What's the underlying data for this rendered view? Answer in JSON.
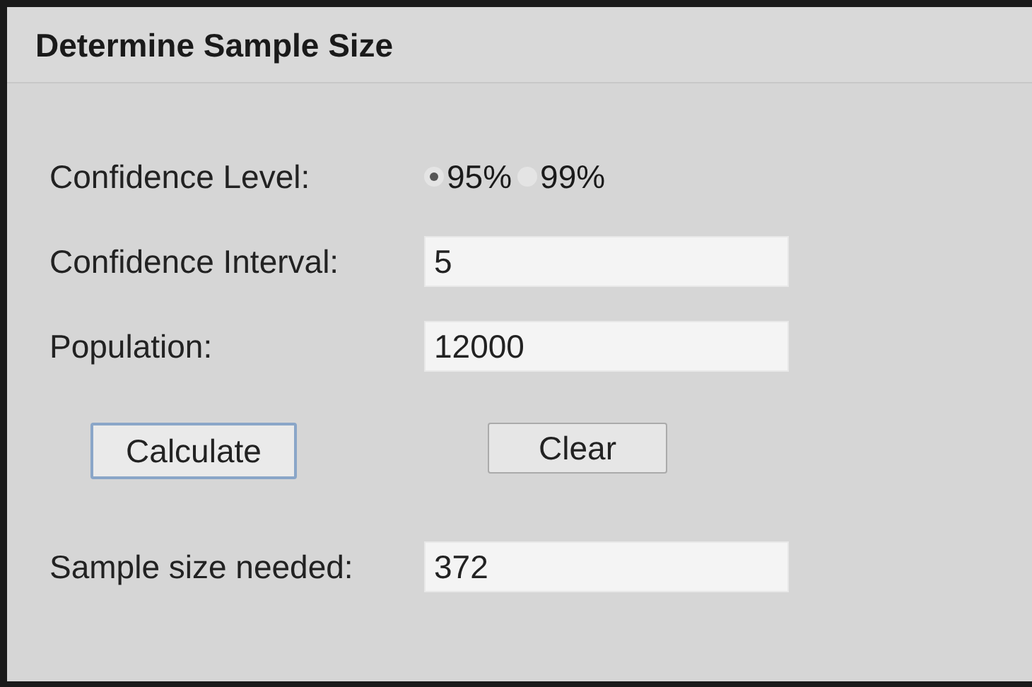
{
  "title": "Determine Sample Size",
  "confidence_level": {
    "label": "Confidence Level:",
    "options": [
      {
        "label": "95%",
        "selected": true
      },
      {
        "label": "99%",
        "selected": false
      }
    ]
  },
  "fields": [
    {
      "label": "Confidence Interval:",
      "value": "5"
    },
    {
      "label": "Population:",
      "value": "12000"
    }
  ],
  "buttons": [
    {
      "label": "Calculate",
      "focused": true
    },
    {
      "label": "Clear",
      "focused": false
    }
  ],
  "result": {
    "label": "Sample size needed:",
    "value": "372"
  }
}
